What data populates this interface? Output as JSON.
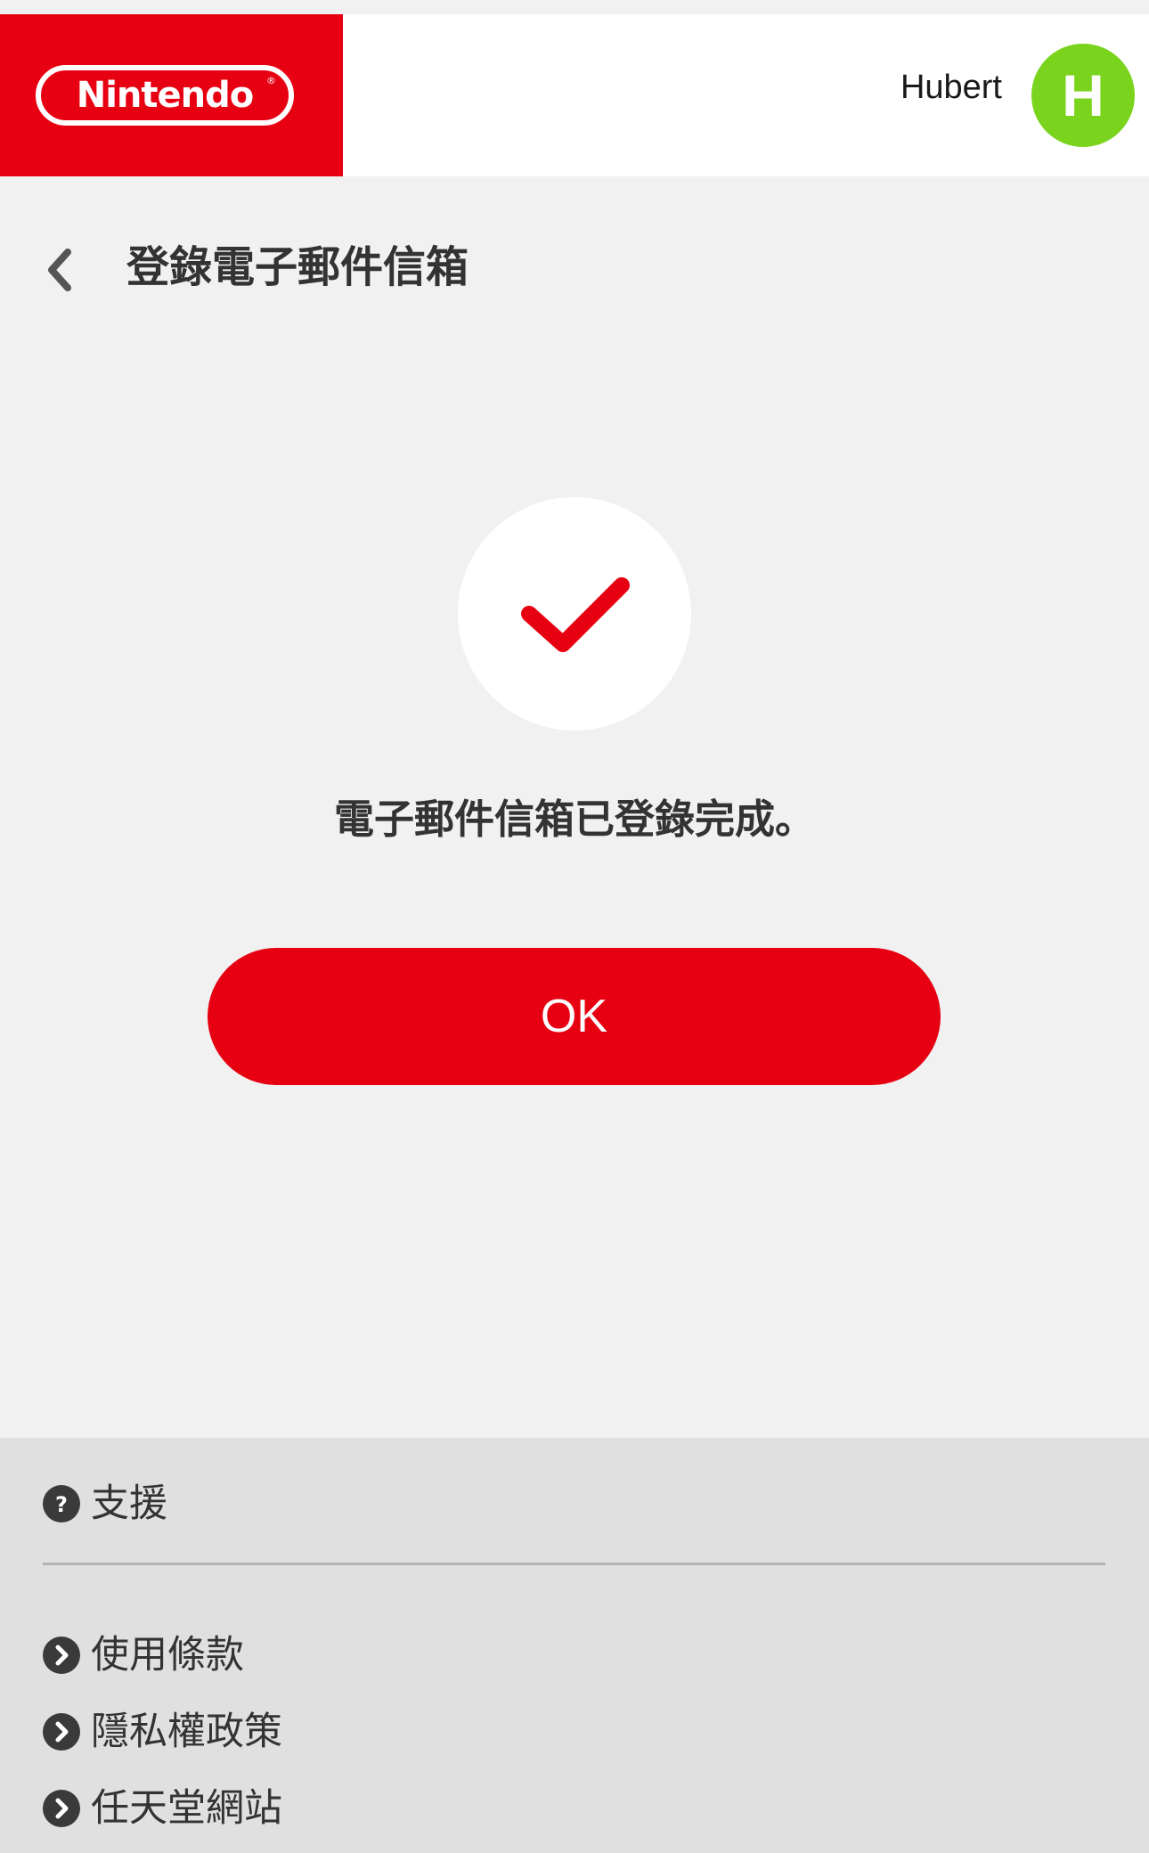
{
  "header": {
    "logo_text": "Nintendo",
    "logo_reg": "®",
    "user_name": "Hubert",
    "avatar_initial": "H",
    "brand_color": "#e60012",
    "avatar_color": "#7ad41e"
  },
  "page": {
    "title": "登錄電子郵件信箱"
  },
  "main": {
    "message": "電子郵件信箱已登錄完成。",
    "ok_label": "OK"
  },
  "footer": {
    "support_label": "支援",
    "links": [
      {
        "label": "使用條款"
      },
      {
        "label": "隱私權政策"
      },
      {
        "label": "任天堂網站"
      }
    ]
  }
}
